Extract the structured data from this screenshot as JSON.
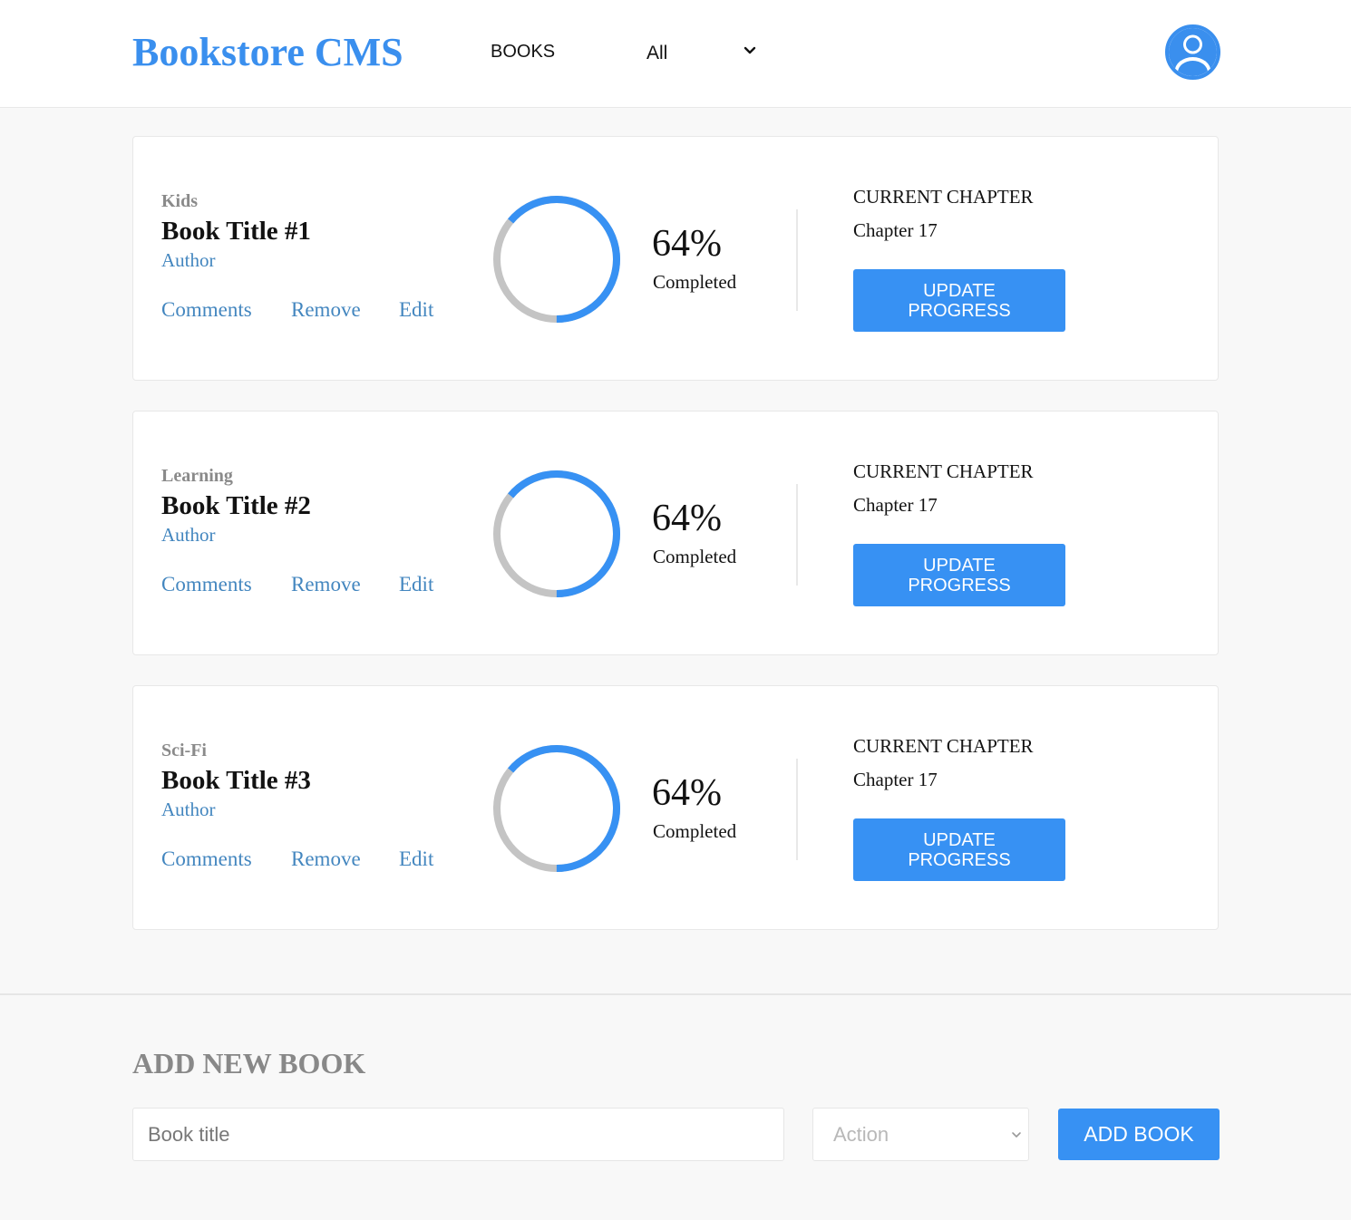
{
  "header": {
    "logo": "Bookstore CMS",
    "nav_books": "BOOKS",
    "filter_value": "All"
  },
  "books": [
    {
      "genre": "Kids",
      "title": "Book Title #1",
      "author": "Author",
      "progress_percent": 64,
      "percent_label": "64%",
      "completed_label": "Completed",
      "current_chapter_label": "CURRENT CHAPTER",
      "current_chapter": "Chapter 17",
      "update_label": "UPDATE PROGRESS"
    },
    {
      "genre": "Learning",
      "title": "Book Title #2",
      "author": "Author",
      "progress_percent": 64,
      "percent_label": "64%",
      "completed_label": "Completed",
      "current_chapter_label": "CURRENT CHAPTER",
      "current_chapter": "Chapter 17",
      "update_label": "UPDATE PROGRESS"
    },
    {
      "genre": "Sci-Fi",
      "title": "Book Title #3",
      "author": "Author",
      "progress_percent": 64,
      "percent_label": "64%",
      "completed_label": "Completed",
      "current_chapter_label": "CURRENT CHAPTER",
      "current_chapter": "Chapter 17",
      "update_label": "UPDATE PROGRESS"
    }
  ],
  "book_actions": {
    "comments": "Comments",
    "remove": "Remove",
    "edit": "Edit"
  },
  "form": {
    "title": "ADD NEW BOOK",
    "title_placeholder": "Book title",
    "action_placeholder": "Action",
    "submit_label": "ADD BOOK"
  },
  "colors": {
    "accent": "#3791f3",
    "logo": "#3a8fee",
    "link": "#4386bf",
    "ring_track": "#c4c4c4"
  },
  "icons": {
    "profile": "user-circle-icon",
    "chevron": "chevron-down-icon"
  }
}
